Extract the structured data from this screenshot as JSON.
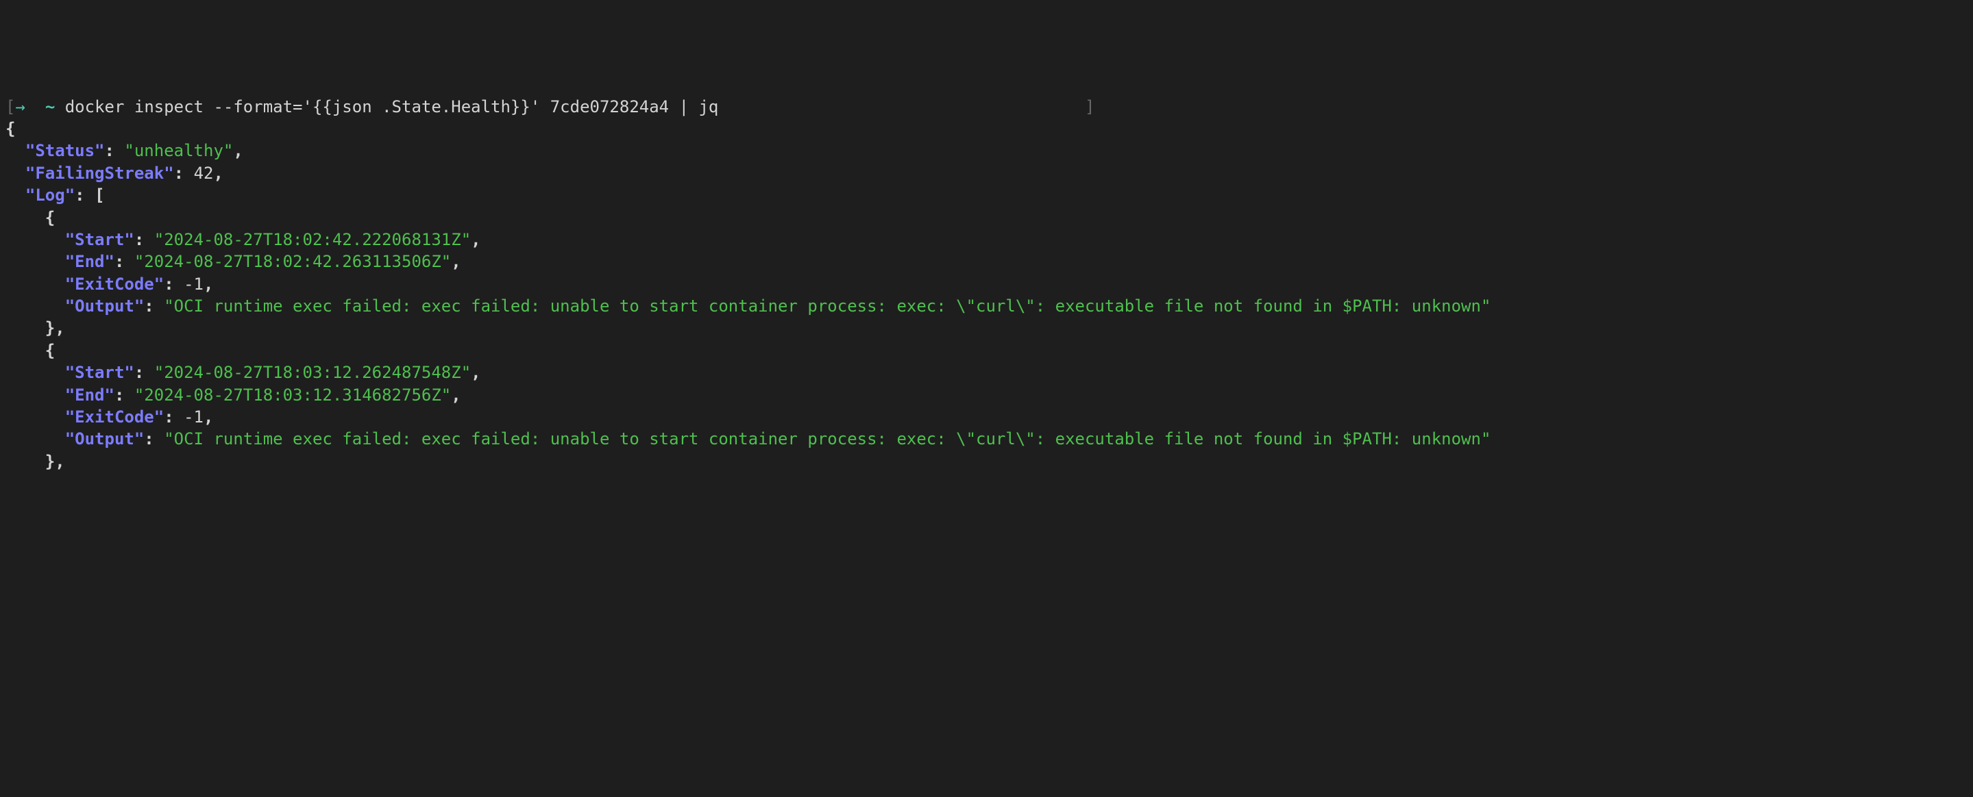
{
  "prompt": {
    "arrow": "→",
    "tilde": "~",
    "command": "docker inspect --format='{{json .State.Health}}' 7cde072824a4 | jq",
    "right_bracket": "]"
  },
  "json_output": {
    "open_brace": "{",
    "status_key": "\"Status\"",
    "status_value": "\"unhealthy\"",
    "failing_streak_key": "\"FailingStreak\"",
    "failing_streak_value": "42",
    "log_key": "\"Log\"",
    "log_open": "[",
    "entries": [
      {
        "open": "{",
        "start_key": "\"Start\"",
        "start_value": "\"2024-08-27T18:02:42.222068131Z\"",
        "end_key": "\"End\"",
        "end_value": "\"2024-08-27T18:02:42.263113506Z\"",
        "exitcode_key": "\"ExitCode\"",
        "exitcode_value": "-1",
        "output_key": "\"Output\"",
        "output_value": "\"OCI runtime exec failed: exec failed: unable to start container process: exec: \\\"curl\\\": executable file not found in $PATH: unknown\"",
        "close": "},"
      },
      {
        "open": "{",
        "start_key": "\"Start\"",
        "start_value": "\"2024-08-27T18:03:12.262487548Z\"",
        "end_key": "\"End\"",
        "end_value": "\"2024-08-27T18:03:12.314682756Z\"",
        "exitcode_key": "\"ExitCode\"",
        "exitcode_value": "-1",
        "output_key": "\"Output\"",
        "output_value": "\"OCI runtime exec failed: exec failed: unable to start container process: exec: \\\"curl\\\": executable file not found in $PATH: unknown\"",
        "close": "},"
      }
    ]
  },
  "punct": {
    "colon_space": ": ",
    "comma": ","
  }
}
